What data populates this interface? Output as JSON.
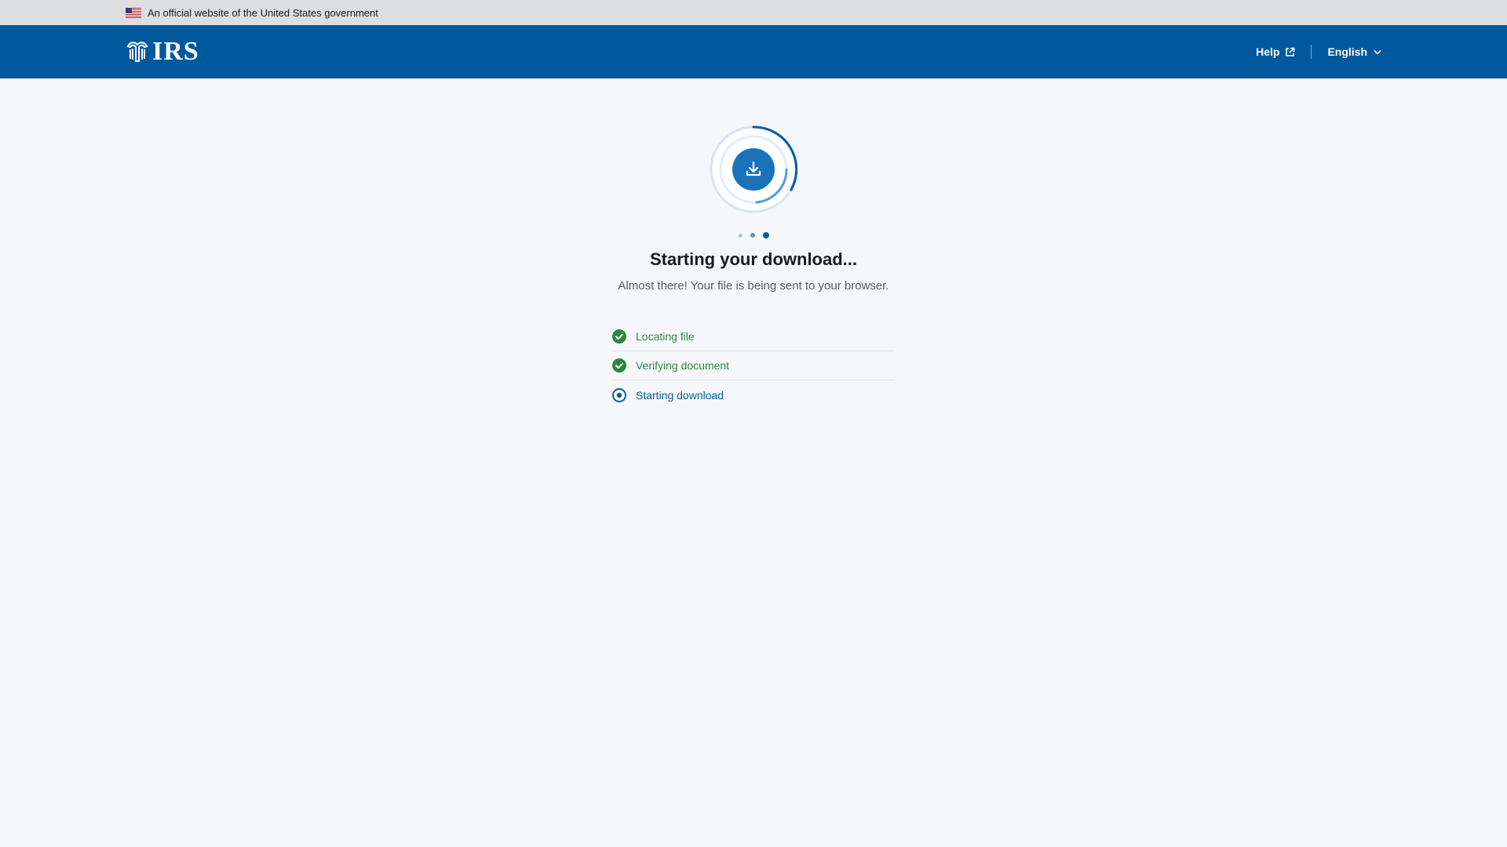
{
  "gov_banner": {
    "text": "An official website of the United States government",
    "flag_icon": "us-flag-icon"
  },
  "header": {
    "logo_text": "IRS",
    "logo_icon": "irs-eagle-icon",
    "help_label": "Help",
    "help_icon": "external-link-icon",
    "language_label": "English",
    "language_icon": "chevron-down-icon",
    "background_color": "#00599c"
  },
  "main": {
    "progress_icon": "download-icon",
    "title": "Starting your download...",
    "subtitle": "Almost there! Your file is being sent to your browser.",
    "steps": [
      {
        "label": "Locating file",
        "status": "done",
        "icon": "check-circle-icon"
      },
      {
        "label": "Verifying document",
        "status": "done",
        "icon": "check-circle-icon"
      },
      {
        "label": "Starting download",
        "status": "active",
        "icon": "radio-active-icon"
      }
    ],
    "current_step": 3,
    "total_steps": 3
  },
  "colors": {
    "done": "#2e8540",
    "active": "#005ea2",
    "background": "#f5f7fa"
  }
}
